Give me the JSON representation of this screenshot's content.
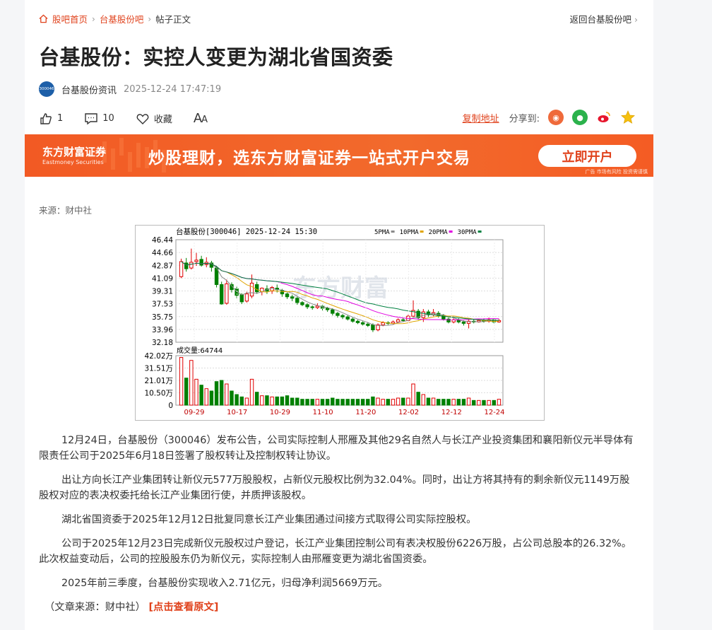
{
  "breadcrumb": {
    "items": [
      "股吧首页",
      "台基股份吧",
      "帖子正文"
    ],
    "back": "返回台基股份吧"
  },
  "title": "台基股份：实控人变更为湖北省国资委",
  "author": {
    "avatar_text": "300046",
    "name": "台基股份资讯",
    "time": "2025-12-24 17:47:19"
  },
  "actions": {
    "likes": "1",
    "comments": "10",
    "favorite": "收藏",
    "font_big": "A",
    "font_small": "A"
  },
  "share": {
    "copy": "复制地址",
    "label": "分享到:"
  },
  "banner": {
    "logo_cn": "东方财富证券",
    "logo_en": "Eastmoney Securities",
    "slogan": "炒股理财，选东方财富证券一站式开户交易",
    "cta": "立即开户",
    "ad": "广告 市场有风险 投资需谨慎"
  },
  "source": "来源：财中社",
  "chart_data": {
    "type": "candlestick",
    "title": "台基股份[300046] 2025-12-24 15:30",
    "legend": [
      {
        "name": "5PMA",
        "color": "#8a8a8a"
      },
      {
        "name": "10PMA",
        "color": "#e0a400"
      },
      {
        "name": "20PMA",
        "color": "#e000e0"
      },
      {
        "name": "30PMA",
        "color": "#008040"
      }
    ],
    "price_ticks": [
      "46.44",
      "44.66",
      "42.87",
      "41.09",
      "39.31",
      "37.53",
      "35.75",
      "33.96",
      "32.18"
    ],
    "ylim": [
      32.18,
      46.44
    ],
    "volume_label": "成交量:64744",
    "volume_ticks": [
      "42.02万",
      "31.51万",
      "21.01万",
      "10.50万",
      "0"
    ],
    "vlim": [
      0,
      42.02
    ],
    "x_ticks": [
      "09-29",
      "10-17",
      "10-29",
      "11-10",
      "11-20",
      "12-02",
      "12-12",
      "12-24"
    ],
    "candles": [
      {
        "o": 41.3,
        "c": 43.4,
        "h": 43.8,
        "l": 41.1,
        "v": 40.5
      },
      {
        "o": 43.2,
        "c": 42.4,
        "h": 43.9,
        "l": 42.0,
        "v": 23.0
      },
      {
        "o": 42.5,
        "c": 43.3,
        "h": 45.2,
        "l": 42.3,
        "v": 38.0
      },
      {
        "o": 43.4,
        "c": 43.6,
        "h": 44.6,
        "l": 42.8,
        "v": 22.0
      },
      {
        "o": 43.7,
        "c": 42.9,
        "h": 44.2,
        "l": 42.7,
        "v": 17.0
      },
      {
        "o": 43.0,
        "c": 43.3,
        "h": 44.0,
        "l": 42.6,
        "v": 14.0
      },
      {
        "o": 43.2,
        "c": 42.6,
        "h": 43.5,
        "l": 42.0,
        "v": 12.0
      },
      {
        "o": 42.5,
        "c": 40.2,
        "h": 42.8,
        "l": 39.8,
        "v": 20.0
      },
      {
        "o": 40.2,
        "c": 37.5,
        "h": 40.6,
        "l": 37.4,
        "v": 21.0
      },
      {
        "o": 37.6,
        "c": 40.3,
        "h": 40.9,
        "l": 37.4,
        "v": 18.0
      },
      {
        "o": 40.2,
        "c": 39.5,
        "h": 40.5,
        "l": 39.1,
        "v": 12.0
      },
      {
        "o": 39.6,
        "c": 38.7,
        "h": 39.9,
        "l": 38.3,
        "v": 9.0
      },
      {
        "o": 38.8,
        "c": 37.8,
        "h": 39.0,
        "l": 37.5,
        "v": 7.0
      },
      {
        "o": 37.9,
        "c": 38.9,
        "h": 39.2,
        "l": 37.7,
        "v": 6.0
      },
      {
        "o": 38.6,
        "c": 40.4,
        "h": 41.6,
        "l": 38.3,
        "v": 22.0
      },
      {
        "o": 40.2,
        "c": 39.2,
        "h": 40.6,
        "l": 38.9,
        "v": 11.0
      },
      {
        "o": 39.2,
        "c": 39.7,
        "h": 39.8,
        "l": 38.7,
        "v": 8.0
      },
      {
        "o": 39.6,
        "c": 39.3,
        "h": 40.1,
        "l": 38.9,
        "v": 8.0
      },
      {
        "o": 39.3,
        "c": 39.8,
        "h": 40.0,
        "l": 38.9,
        "v": 7.0
      },
      {
        "o": 39.7,
        "c": 39.5,
        "h": 40.2,
        "l": 39.1,
        "v": 7.0
      },
      {
        "o": 39.4,
        "c": 38.9,
        "h": 39.6,
        "l": 38.5,
        "v": 7.0
      },
      {
        "o": 38.9,
        "c": 38.5,
        "h": 39.1,
        "l": 38.2,
        "v": 8.0
      },
      {
        "o": 38.5,
        "c": 38.3,
        "h": 38.8,
        "l": 37.9,
        "v": 6.0
      },
      {
        "o": 38.3,
        "c": 37.7,
        "h": 38.5,
        "l": 37.4,
        "v": 6.0
      },
      {
        "o": 37.7,
        "c": 37.4,
        "h": 37.9,
        "l": 37.2,
        "v": 5.0
      },
      {
        "o": 37.4,
        "c": 37.1,
        "h": 37.6,
        "l": 36.8,
        "v": 5.0
      },
      {
        "o": 37.1,
        "c": 37.0,
        "h": 37.3,
        "l": 36.7,
        "v": 5.0
      },
      {
        "o": 37.0,
        "c": 37.2,
        "h": 37.6,
        "l": 36.8,
        "v": 5.0
      },
      {
        "o": 37.2,
        "c": 36.9,
        "h": 37.4,
        "l": 36.6,
        "v": 5.0
      },
      {
        "o": 36.9,
        "c": 36.7,
        "h": 37.1,
        "l": 36.4,
        "v": 5.0
      },
      {
        "o": 36.7,
        "c": 36.2,
        "h": 36.9,
        "l": 35.9,
        "v": 6.0
      },
      {
        "o": 36.2,
        "c": 35.9,
        "h": 36.4,
        "l": 35.6,
        "v": 5.0
      },
      {
        "o": 35.9,
        "c": 35.7,
        "h": 36.1,
        "l": 35.4,
        "v": 5.0
      },
      {
        "o": 35.7,
        "c": 35.4,
        "h": 35.9,
        "l": 35.2,
        "v": 5.0
      },
      {
        "o": 35.4,
        "c": 35.1,
        "h": 35.6,
        "l": 34.9,
        "v": 5.0
      },
      {
        "o": 35.1,
        "c": 34.9,
        "h": 35.3,
        "l": 34.7,
        "v": 5.0
      },
      {
        "o": 34.9,
        "c": 34.7,
        "h": 35.1,
        "l": 34.5,
        "v": 5.0
      },
      {
        "o": 34.7,
        "c": 34.5,
        "h": 34.9,
        "l": 34.3,
        "v": 5.0
      },
      {
        "o": 34.6,
        "c": 33.9,
        "h": 34.8,
        "l": 33.6,
        "v": 7.0
      },
      {
        "o": 33.9,
        "c": 34.6,
        "h": 34.8,
        "l": 33.7,
        "v": 6.0
      },
      {
        "o": 34.6,
        "c": 34.9,
        "h": 35.1,
        "l": 34.4,
        "v": 5.0
      },
      {
        "o": 34.9,
        "c": 34.8,
        "h": 35.1,
        "l": 34.6,
        "v": 5.0
      },
      {
        "o": 34.8,
        "c": 35.0,
        "h": 35.2,
        "l": 34.6,
        "v": 5.0
      },
      {
        "o": 35.0,
        "c": 35.3,
        "h": 35.5,
        "l": 34.9,
        "v": 6.0
      },
      {
        "o": 35.3,
        "c": 35.2,
        "h": 35.6,
        "l": 35.0,
        "v": 6.0
      },
      {
        "o": 35.2,
        "c": 35.8,
        "h": 36.0,
        "l": 35.1,
        "v": 6.0
      },
      {
        "o": 35.8,
        "c": 36.6,
        "h": 38.0,
        "l": 35.7,
        "v": 18.0
      },
      {
        "o": 36.5,
        "c": 35.6,
        "h": 36.8,
        "l": 35.3,
        "v": 11.0
      },
      {
        "o": 35.6,
        "c": 36.4,
        "h": 36.8,
        "l": 35.0,
        "v": 9.0
      },
      {
        "o": 36.4,
        "c": 36.0,
        "h": 36.7,
        "l": 35.7,
        "v": 6.0
      },
      {
        "o": 36.0,
        "c": 36.3,
        "h": 36.8,
        "l": 35.8,
        "v": 6.0
      },
      {
        "o": 36.2,
        "c": 35.9,
        "h": 36.5,
        "l": 35.6,
        "v": 5.0
      },
      {
        "o": 35.9,
        "c": 35.4,
        "h": 36.1,
        "l": 35.2,
        "v": 5.0
      },
      {
        "o": 35.4,
        "c": 35.0,
        "h": 35.6,
        "l": 34.8,
        "v": 5.0
      },
      {
        "o": 35.0,
        "c": 35.3,
        "h": 35.5,
        "l": 34.8,
        "v": 5.0
      },
      {
        "o": 35.3,
        "c": 35.0,
        "h": 35.5,
        "l": 34.8,
        "v": 5.0
      },
      {
        "o": 35.0,
        "c": 34.8,
        "h": 35.2,
        "l": 34.5,
        "v": 5.0
      },
      {
        "o": 34.8,
        "c": 35.1,
        "h": 35.3,
        "l": 34.1,
        "v": 6.0
      },
      {
        "o": 35.1,
        "c": 35.0,
        "h": 35.4,
        "l": 34.8,
        "v": 4.0
      },
      {
        "o": 35.0,
        "c": 35.2,
        "h": 35.4,
        "l": 34.9,
        "v": 4.0
      },
      {
        "o": 35.2,
        "c": 35.1,
        "h": 35.5,
        "l": 34.9,
        "v": 4.0
      },
      {
        "o": 35.1,
        "c": 35.3,
        "h": 35.6,
        "l": 34.9,
        "v": 4.0
      },
      {
        "o": 35.3,
        "c": 35.0,
        "h": 35.5,
        "l": 34.8,
        "v": 4.0
      },
      {
        "o": 35.0,
        "c": 35.2,
        "h": 35.4,
        "l": 34.9,
        "v": 5.0
      }
    ]
  },
  "article": {
    "paragraphs": [
      "12月24日，台基股份（300046）发布公告，公司实际控制人邢雁及其他29名自然人与长江产业投资集团和襄阳新仪元半导体有限责任公司于2025年6月18日签署了股权转让及控制权转让协议。",
      "出让方向长江产业集团转让新仪元577万股股权，占新仪元股权比例为32.04%。同时，出让方将其持有的剩余新仪元1149万股股权对应的表决权委托给长江产业集团行使，并质押该股权。",
      "湖北省国资委于2025年12月12日批复同意长江产业集团通过间接方式取得公司实际控股权。",
      "公司于2025年12月23日完成新仪元股权过户登记，长江产业集团控制公司有表决权股份6226万股，占公司总股本的26.32%。此次权益变动后，公司的控股股东仍为新仪元，实际控制人由邢雁变更为湖北省国资委。",
      "2025年前三季度，台基股份实现收入2.71亿元，归母净利润5669万元。"
    ],
    "footer_prefix": "（文章来源：财中社）",
    "footer_link": "[点击查看原文]"
  },
  "colors": {
    "accent": "#e0421c",
    "up": "#e00000",
    "down": "#008000"
  }
}
